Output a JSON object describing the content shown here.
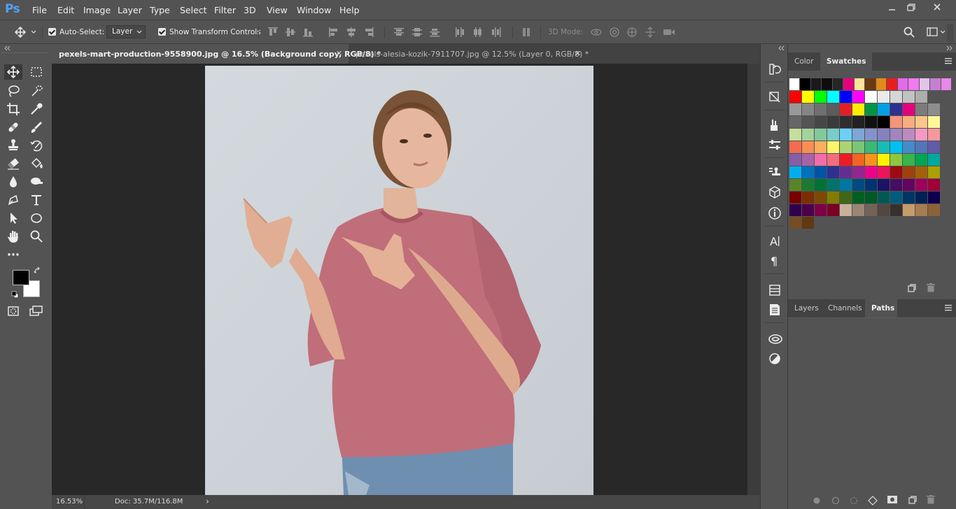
{
  "app": {
    "logo": "Ps"
  },
  "menu": [
    "File",
    "Edit",
    "Image",
    "Layer",
    "Type",
    "Select",
    "Filter",
    "3D",
    "View",
    "Window",
    "Help"
  ],
  "options": {
    "auto_select_label": "Auto-Select:",
    "auto_select_value": "Layer",
    "show_transform_label": "Show Transform Controls",
    "mode_3d_label": "3D Mode:"
  },
  "tabs": [
    {
      "label": "pexels-mart-production-9558900.jpg @ 16.5% (Background copy, RGB/8) *",
      "active": true
    },
    {
      "label": "pexels-alesia-kozik-7911707.jpg @ 12.5% (Layer 0, RGB/8) *",
      "active": false
    }
  ],
  "status": {
    "zoom": "16.53%",
    "doc": "Doc: 35.7M/116.8M",
    "arrow": "›"
  },
  "panels": {
    "top_tabs": [
      "Color",
      "Swatches"
    ],
    "bottom_tabs": [
      "Layers",
      "Channels",
      "Paths"
    ]
  },
  "swatches": [
    [
      "#ffffff",
      "#000000",
      "#1a1a1a",
      "#0d0d0d",
      "#262626",
      "#e5007e",
      "#fde39a",
      "#6b3a10",
      "#e08a1c",
      "#e81e1e",
      "#e06ce8",
      "#f07af0",
      "#e2c4e8",
      "#c47fd1",
      "#e888ea"
    ],
    [
      "#ff0000",
      "#ffff00",
      "#00ff00",
      "#00ffff",
      "#0000ff",
      "#ff00ff",
      "#ffffff",
      "#ebebeb",
      "#d6d6d6",
      "#c2c2c2",
      "#adadad"
    ],
    [
      "#999999",
      "#858585",
      "#707070",
      "#5c5c5c",
      "#e31e24",
      "#ffed00",
      "#009640",
      "#00a0e3",
      "#2e3192",
      "#e6007e",
      "#7c7c7c",
      "#8d8d8d"
    ],
    [
      "#666666",
      "#545454",
      "#474747",
      "#3b3b3b",
      "#2e2e2e",
      "#222222",
      "#111111",
      "#000000",
      "#f4947c",
      "#f9ad81",
      "#fdc68a",
      "#fff799"
    ],
    [
      "#c4df9b",
      "#a3d39c",
      "#82ca9c",
      "#7accc8",
      "#6dcff6",
      "#7da7d9",
      "#8393ca",
      "#8781bd",
      "#a186be",
      "#bc8cbf",
      "#f49ac1",
      "#f6989d"
    ],
    [
      "#f26c4f",
      "#f68e56",
      "#fbaf5d",
      "#fff568",
      "#acd373",
      "#7cc576",
      "#3bb878",
      "#1abbb4",
      "#00bff3",
      "#438ccb",
      "#5574b9",
      "#605ca8"
    ],
    [
      "#855fa8",
      "#a763a8",
      "#f06eaa",
      "#f26d7d",
      "#ed1c24",
      "#f26522",
      "#f7941d",
      "#fff200",
      "#8dc73f",
      "#39b54a",
      "#00a651",
      "#00a99d"
    ],
    [
      "#00aeef",
      "#0072bc",
      "#0054a6",
      "#2e3192",
      "#662d91",
      "#92278f",
      "#ec008c",
      "#ed145b",
      "#9e0b0f",
      "#a0410d",
      "#a36209",
      "#aba000"
    ],
    [
      "#598527",
      "#1a7b30",
      "#007236",
      "#00746b",
      "#0076a3",
      "#004a80",
      "#003471",
      "#1b1464",
      "#440e62",
      "#630460",
      "#9e005d",
      "#9e0039"
    ],
    [
      "#790000",
      "#7b2e00",
      "#7d4900",
      "#827b00",
      "#406618",
      "#005e20",
      "#005826",
      "#005952",
      "#005b7f",
      "#003663",
      "#002157",
      "#0d004c"
    ],
    [
      "#32004b",
      "#4b0049",
      "#7b0046",
      "#7a0026",
      "#c7b299",
      "#998675",
      "#736357",
      "#534741",
      "#37302d",
      "#c69c6d",
      "#a67c52",
      "#8c6239"
    ],
    [
      "#754c24",
      "#603913"
    ]
  ]
}
